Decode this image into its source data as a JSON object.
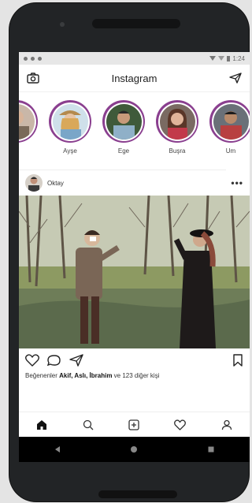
{
  "status_bar": {
    "time": "1:24"
  },
  "header": {
    "title": "Instagram"
  },
  "stories": [
    {
      "name": ""
    },
    {
      "name": "Ayşe"
    },
    {
      "name": "Ege"
    },
    {
      "name": "Buşra"
    },
    {
      "name": "Um"
    }
  ],
  "post": {
    "username": "Oktay",
    "more_label": "•••",
    "likes_prefix": "Beğenenler",
    "likes_names": "Akif, Aslı, İbrahim",
    "likes_suffix": "ve 123 diğer kişi"
  },
  "icons": {
    "camera": "camera-icon",
    "send": "send-icon",
    "heart": "heart-icon",
    "comment": "comment-icon",
    "share": "share-icon",
    "bookmark": "bookmark-icon",
    "home": "home-icon",
    "search": "search-icon",
    "add": "add-icon",
    "activity": "activity-icon",
    "profile": "profile-icon"
  },
  "colors": {
    "story_ring": "#8a3f8f",
    "nav_bar": "#000000"
  }
}
